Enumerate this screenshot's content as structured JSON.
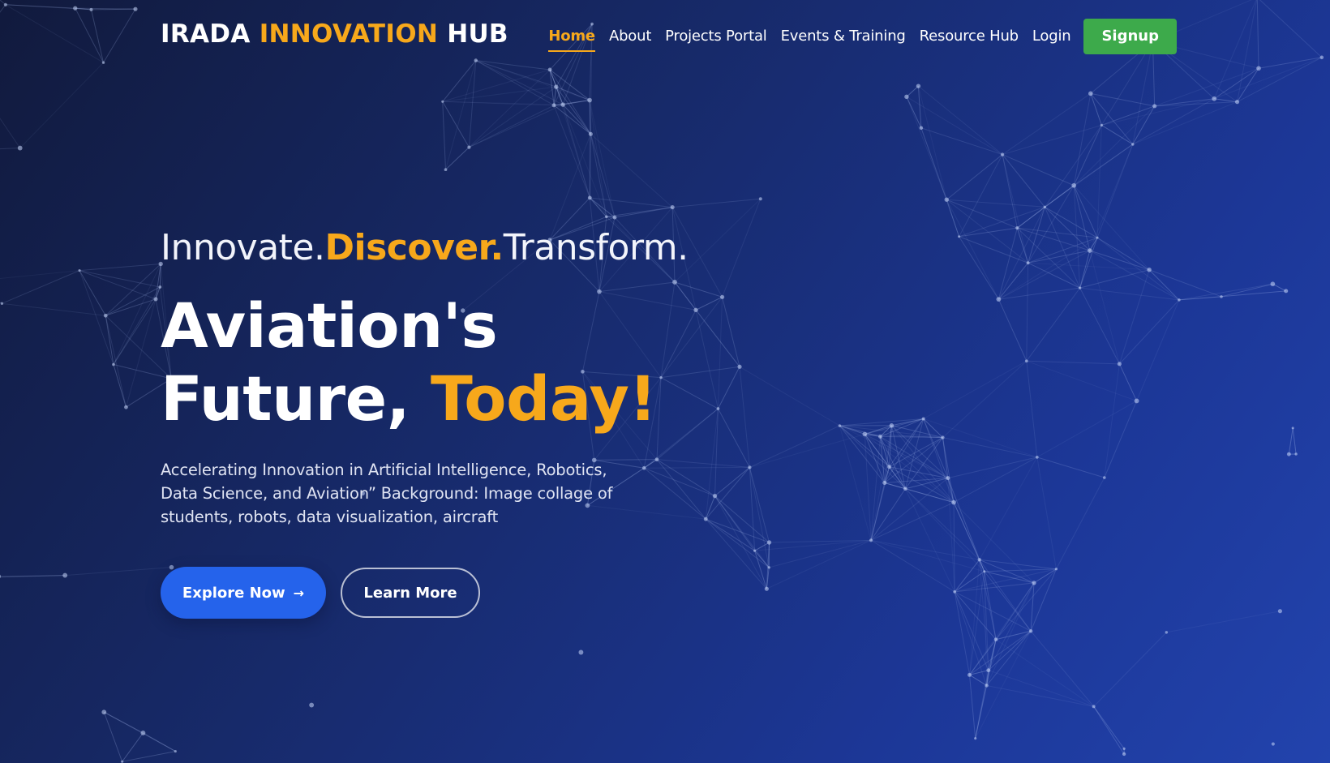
{
  "header": {
    "logo": {
      "part1": "IRADA ",
      "part2": "INNOVATION",
      "part3": " HUB"
    },
    "nav": [
      {
        "label": "Home",
        "active": true
      },
      {
        "label": "About",
        "active": false
      },
      {
        "label": "Projects Portal",
        "active": false
      },
      {
        "label": "Events & Training",
        "active": false
      },
      {
        "label": "Resource Hub",
        "active": false
      },
      {
        "label": "Login",
        "active": false
      }
    ],
    "signup_label": "Signup"
  },
  "hero": {
    "tagline": {
      "part1": "Innovate.",
      "part2": "Discover.",
      "part3": "Transform."
    },
    "headline": {
      "line1": "Aviation's",
      "line2_part1": "Future, ",
      "line2_part2": "Today!"
    },
    "description": "Accelerating Innovation in Artificial Intelligence, Robotics, Data Science, and Aviation” Background: Image collage of students, robots, data visualization, aircraft",
    "primary_button": {
      "label": "Explore Now",
      "icon": "arrow-right-icon"
    },
    "secondary_button": {
      "label": "Learn More"
    }
  },
  "colors": {
    "accent": "#f7a81b",
    "signup": "#3daa4b",
    "primary_button": "#2563eb",
    "background_start": "#111a3d",
    "background_end": "#2243ad"
  }
}
